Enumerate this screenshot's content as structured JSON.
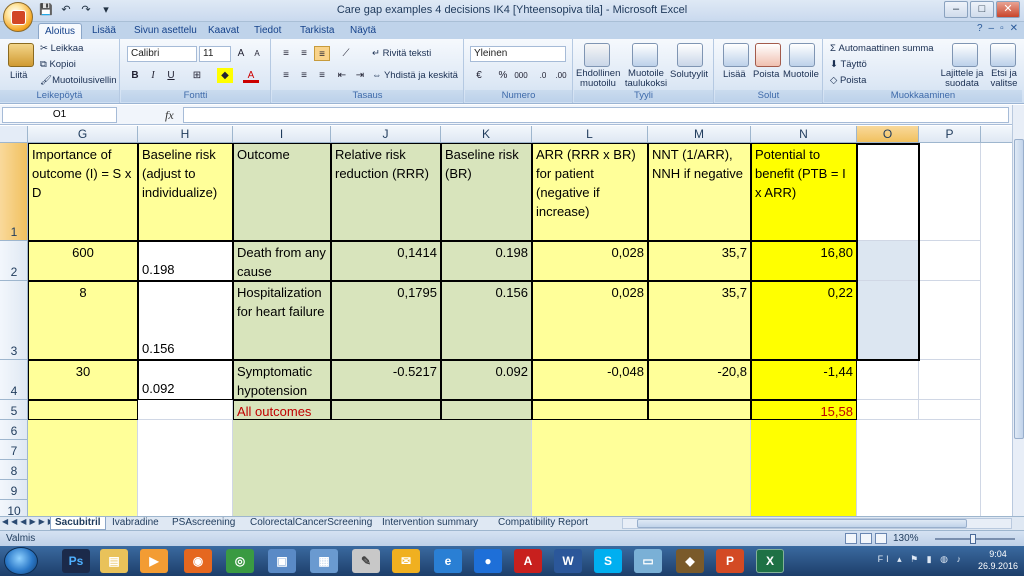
{
  "window": {
    "title": "Care gap examples 4 decisions IK4  [Yhteensopiva tila] - Microsoft Excel"
  },
  "ribbon": {
    "tabs": [
      "Aloitus",
      "Lisää",
      "Sivun asettelu",
      "Kaavat",
      "Tiedot",
      "Tarkista",
      "Näytä"
    ],
    "clipboard": {
      "paste": "Liitä",
      "cut": "Leikkaa",
      "copy": "Kopioi",
      "format_painter": "Muotoilusivellin",
      "label": "Leikepöytä"
    },
    "font": {
      "name": "Calibri",
      "size": "11",
      "label": "Fontti"
    },
    "alignment": {
      "wrap": "Rivitä teksti",
      "merge": "Yhdistä ja keskitä",
      "label": "Tasaus"
    },
    "number": {
      "format": "Yleinen",
      "label": "Numero"
    },
    "styles": {
      "conditional": "Ehdollinen muotoilu",
      "as_table": "Muotoile taulukoksi",
      "cell_styles": "Solutyylit",
      "label": "Tyyli"
    },
    "cells": {
      "insert": "Lisää",
      "delete": "Poista",
      "format": "Muotoile",
      "label": "Solut"
    },
    "editing": {
      "autosum": "Automaattinen summa",
      "fill": "Täyttö",
      "clear": "Poista",
      "sort": "Lajittele ja suodata",
      "find": "Etsi ja valitse",
      "label": "Muokkaaminen"
    }
  },
  "formula_bar": {
    "name_box": "O1",
    "fx": "fx",
    "value": ""
  },
  "sheet": {
    "columns": [
      "G",
      "H",
      "I",
      "J",
      "K",
      "L",
      "M",
      "N",
      "O",
      "P"
    ],
    "rows": [
      "1",
      "2",
      "3",
      "4",
      "5",
      "6",
      "7",
      "8",
      "9",
      "10"
    ],
    "headers": {
      "G": "Importance of outcome (I) = S x D",
      "H": "Baseline risk (adjust to individualize)",
      "I": "Outcome",
      "J": "Relative risk reduction (RRR)",
      "K": "Baseline risk (BR)",
      "L": "ARR (RRR x BR) for patient (negative if increase)",
      "M": "NNT (1/ARR), NNH if negative",
      "N": "Potential to benefit (PTB = I x ARR)"
    },
    "data": [
      {
        "G": "600",
        "H": "0.198",
        "I": "Death from any cause",
        "J": "0,1414",
        "K": "0.198",
        "L": "0,028",
        "M": "35,7",
        "N": "16,80"
      },
      {
        "G": "8",
        "H": "0.156",
        "I": "Hospitalization for heart failure",
        "J": "0,1795",
        "K": "0.156",
        "L": "0,028",
        "M": "35,7",
        "N": "0,22"
      },
      {
        "G": "30",
        "H": "0.092",
        "I": "Symptomatic hypotension",
        "J": "-0.5217",
        "K": "0.092",
        "L": "-0,048",
        "M": "-20,8",
        "N": "-1,44"
      }
    ],
    "total": {
      "I": "All outcomes",
      "N": "15,58"
    }
  },
  "sheet_tabs": [
    "Sacubitril",
    "Ivabradine",
    "PSAscreening",
    "ColorectalCancerScreening",
    "Intervention summary",
    "Compatibility Report"
  ],
  "status": {
    "ready": "Valmis",
    "zoom": "130%"
  },
  "taskbar": {
    "time": "9:04",
    "date": "26.9.2016",
    "lang": "FI"
  },
  "colors": {
    "yellow_light": "#ffff99",
    "green": "#d8e4bc",
    "yellow": "#ffff00",
    "red_text": "#c00000"
  }
}
